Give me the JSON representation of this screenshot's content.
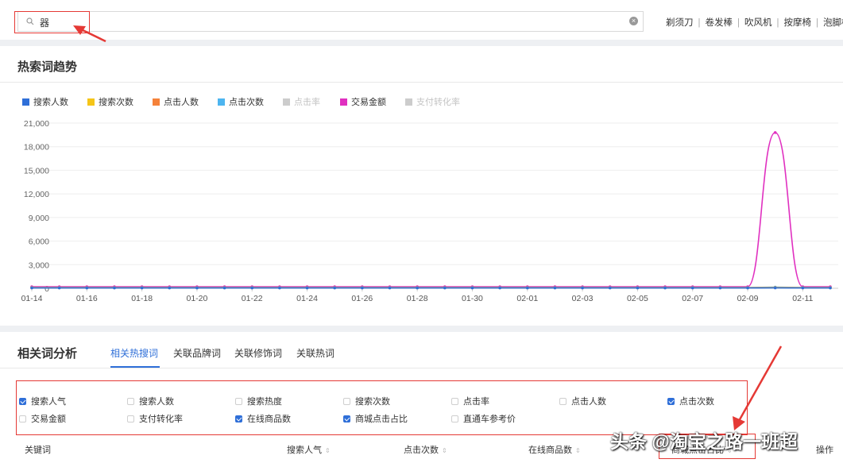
{
  "search": {
    "value": "器",
    "hot_links": [
      "剃须刀",
      "卷发棒",
      "吹风机",
      "按摩椅",
      "泡脚桶"
    ]
  },
  "trend": {
    "title": "热索词趋势",
    "legend": [
      {
        "label": "搜索人数",
        "color": "#2f6fd8",
        "active": true
      },
      {
        "label": "搜索次数",
        "color": "#f5c518",
        "active": true
      },
      {
        "label": "点击人数",
        "color": "#f5823a",
        "active": true
      },
      {
        "label": "点击次数",
        "color": "#4db5f0",
        "active": true
      },
      {
        "label": "点击率",
        "color": "#cccccc",
        "active": false
      },
      {
        "label": "交易金额",
        "color": "#e030c0",
        "active": true
      },
      {
        "label": "支付转化率",
        "color": "#cccccc",
        "active": false
      }
    ]
  },
  "chart_data": {
    "type": "line",
    "x": [
      "01-14",
      "01-15",
      "01-16",
      "01-17",
      "01-18",
      "01-19",
      "01-20",
      "01-21",
      "01-22",
      "01-23",
      "01-24",
      "01-25",
      "01-26",
      "01-27",
      "01-28",
      "01-29",
      "01-30",
      "01-31",
      "02-01",
      "02-02",
      "02-03",
      "02-04",
      "02-05",
      "02-06",
      "02-07",
      "02-08",
      "02-09",
      "02-10",
      "02-11",
      "02-12"
    ],
    "x_tick_labels": [
      "01-14",
      "01-16",
      "01-18",
      "01-20",
      "01-22",
      "01-24",
      "01-26",
      "01-28",
      "01-30",
      "02-01",
      "02-03",
      "02-05",
      "02-07",
      "02-09",
      "02-11"
    ],
    "y_tick_labels": [
      "0",
      "3,000",
      "6,000",
      "9,000",
      "12,000",
      "15,000",
      "18,000",
      "21,000"
    ],
    "ylim": [
      0,
      21000
    ],
    "series": [
      {
        "name": "交易金额",
        "color": "#e030c0",
        "values": [
          200,
          200,
          200,
          200,
          200,
          200,
          200,
          200,
          200,
          200,
          200,
          200,
          200,
          200,
          200,
          200,
          200,
          200,
          200,
          200,
          200,
          200,
          200,
          200,
          200,
          200,
          200,
          19800,
          200,
          200
        ]
      },
      {
        "name": "点击次数",
        "color": "#4db5f0",
        "values": [
          100,
          100,
          100,
          100,
          100,
          100,
          100,
          100,
          100,
          100,
          100,
          100,
          100,
          100,
          100,
          100,
          100,
          100,
          100,
          100,
          100,
          100,
          100,
          100,
          100,
          100,
          100,
          150,
          100,
          100
        ]
      },
      {
        "name": "点击人数",
        "color": "#f5823a",
        "values": [
          80,
          80,
          80,
          80,
          80,
          80,
          80,
          80,
          80,
          80,
          80,
          80,
          80,
          80,
          80,
          80,
          80,
          80,
          80,
          80,
          80,
          80,
          80,
          80,
          80,
          80,
          80,
          100,
          80,
          80
        ]
      },
      {
        "name": "搜索次数",
        "color": "#f5c518",
        "values": [
          60,
          60,
          60,
          60,
          60,
          60,
          60,
          60,
          60,
          60,
          60,
          60,
          60,
          60,
          60,
          60,
          60,
          60,
          60,
          60,
          60,
          60,
          60,
          60,
          60,
          60,
          60,
          70,
          60,
          60
        ]
      },
      {
        "name": "搜索人数",
        "color": "#2f6fd8",
        "values": [
          40,
          40,
          40,
          40,
          40,
          40,
          40,
          40,
          40,
          40,
          40,
          40,
          40,
          40,
          40,
          40,
          40,
          40,
          40,
          40,
          40,
          40,
          40,
          40,
          40,
          40,
          40,
          50,
          40,
          40
        ]
      }
    ]
  },
  "related": {
    "title": "相关词分析",
    "tabs": [
      "相关热搜词",
      "关联品牌词",
      "关联修饰词",
      "关联热词"
    ],
    "active_tab": 0,
    "filters": [
      {
        "label": "搜索人气",
        "checked": true
      },
      {
        "label": "搜索人数",
        "checked": false
      },
      {
        "label": "搜索热度",
        "checked": false
      },
      {
        "label": "搜索次数",
        "checked": false
      },
      {
        "label": "点击率",
        "checked": false
      },
      {
        "label": "点击人数",
        "checked": false
      },
      {
        "label": "点击次数",
        "checked": true
      },
      {
        "label": "交易金额",
        "checked": false
      },
      {
        "label": "支付转化率",
        "checked": false
      },
      {
        "label": "在线商品数",
        "checked": true
      },
      {
        "label": "商城点击占比",
        "checked": true
      },
      {
        "label": "直通车参考价",
        "checked": false
      }
    ],
    "columns": [
      "关键词",
      "搜索人气",
      "点击次数",
      "在线商品数",
      "商城点击占比",
      "操作"
    ]
  },
  "watermark": "头条 @淘宝之路一班超"
}
